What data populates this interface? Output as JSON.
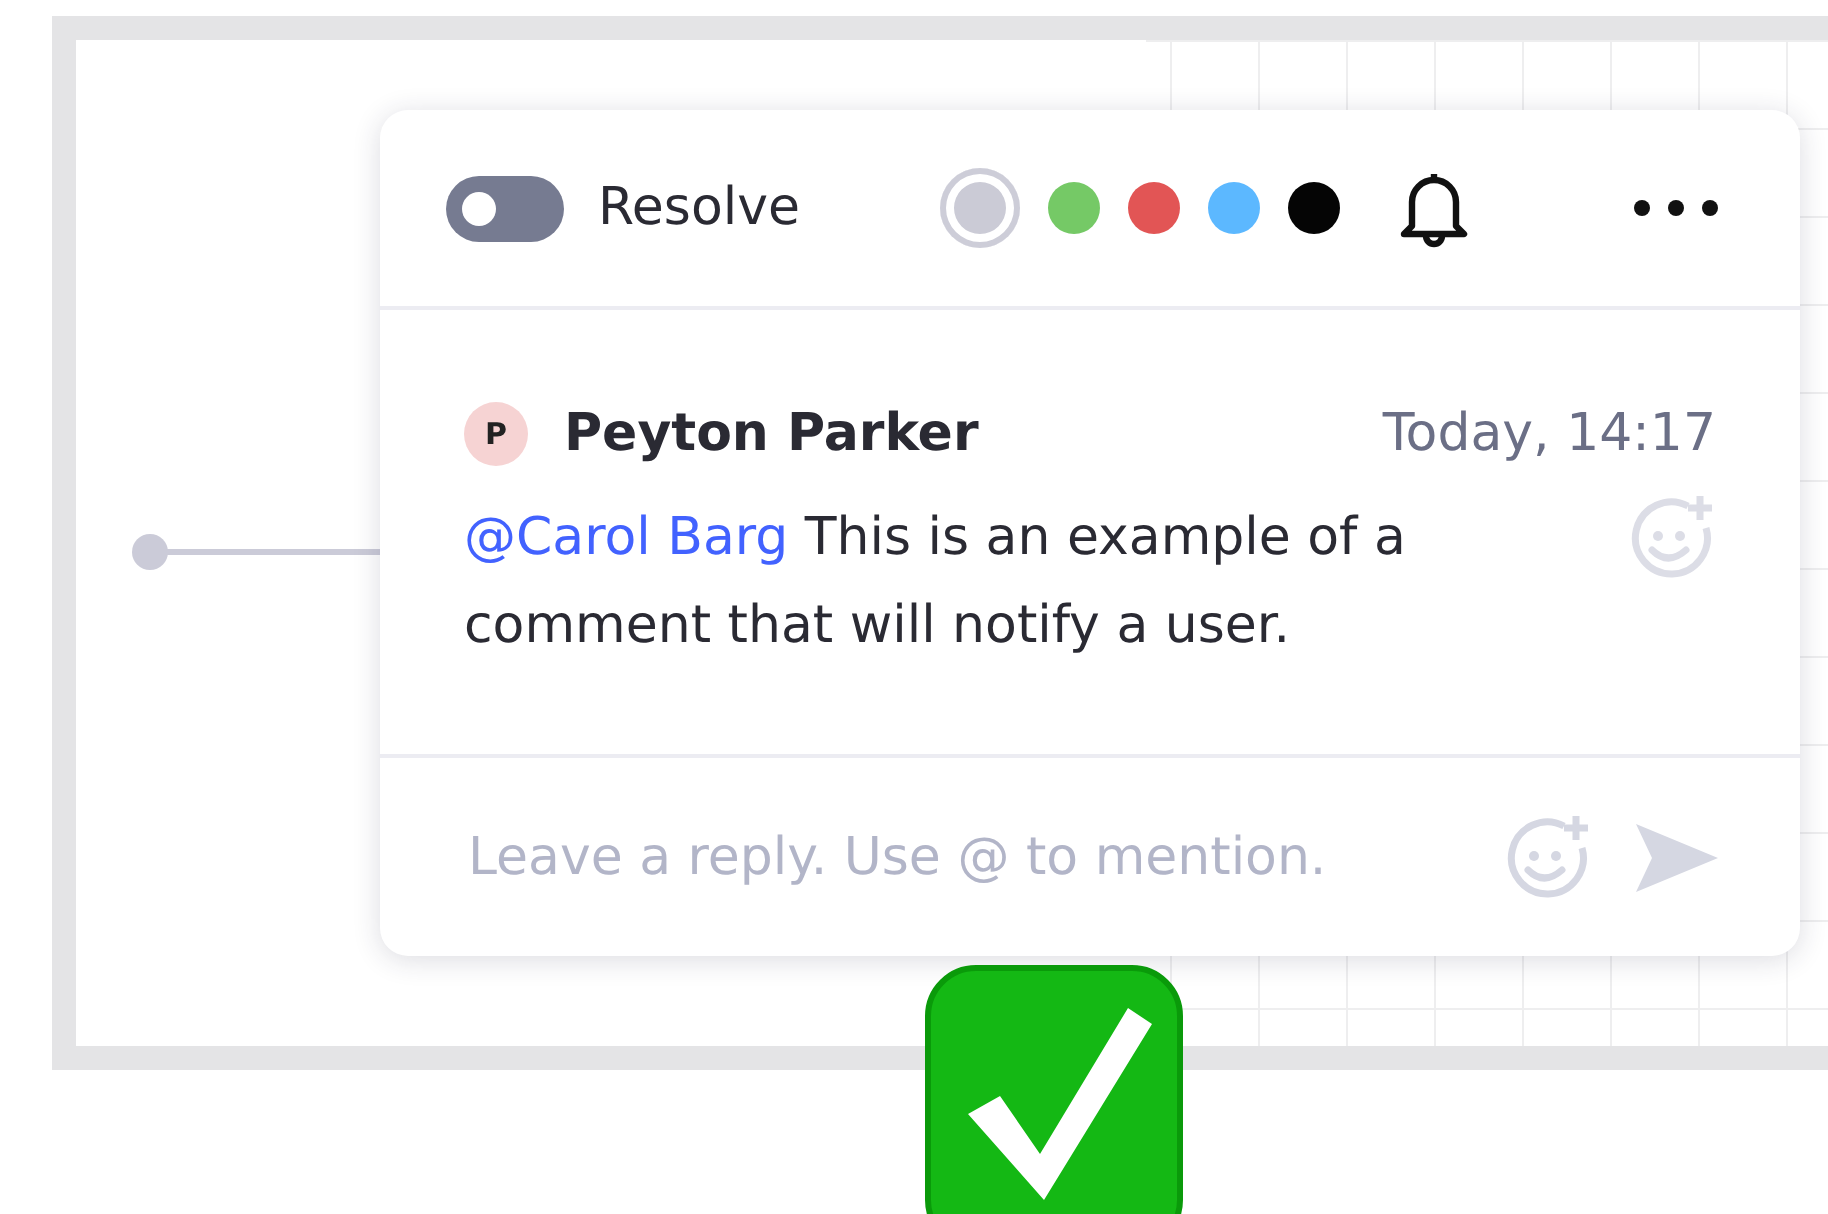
{
  "toolbar": {
    "resolve": {
      "label": "Resolve",
      "on": false
    },
    "colors": [
      {
        "color": "#cbcbd6",
        "selected": true
      },
      {
        "color": "#75c966",
        "selected": false
      },
      {
        "color": "#e25555",
        "selected": false
      },
      {
        "color": "#5cb8ff",
        "selected": false
      },
      {
        "color": "#050505",
        "selected": false
      }
    ]
  },
  "comment": {
    "avatar": "P",
    "author": "Peyton Parker",
    "time": "Today, 14:17",
    "mention": "@Carol Barg",
    "text": "This is an example of a comment that will notify a user."
  },
  "reply": {
    "placeholder": "Leave a reply. Use @ to mention."
  }
}
